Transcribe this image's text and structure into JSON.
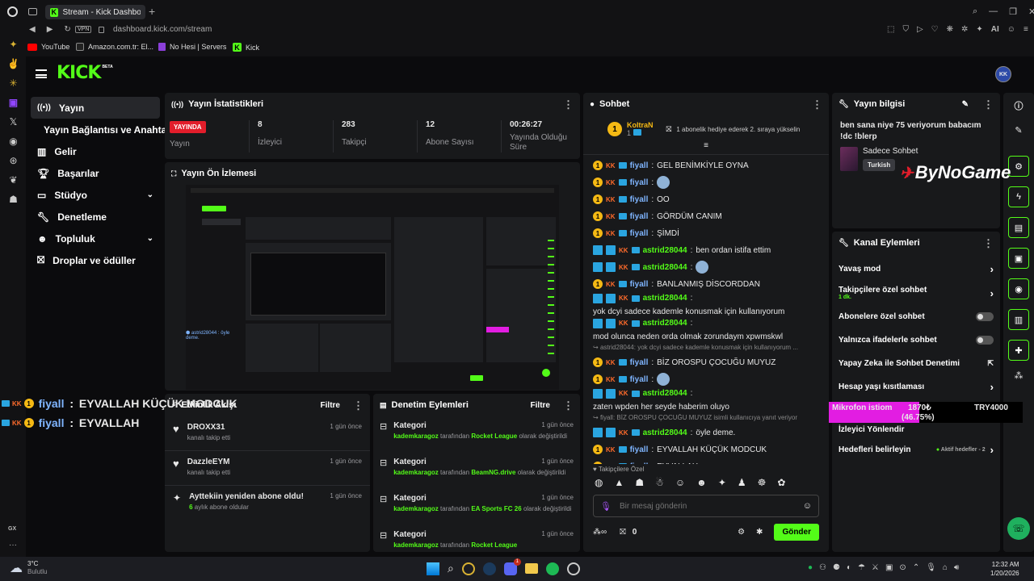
{
  "browser": {
    "tab_title": "Stream - Kick Dashboard",
    "address": "dashboard.kick.com/stream",
    "address_domain": "dashboard.kick.com",
    "address_path": "/stream",
    "vpn_label": "VPN",
    "ai_label": "AI",
    "bookmarks": [
      "YouTube",
      "Amazon.com.tr: El...",
      "No Hesi | Servers",
      "Kick"
    ]
  },
  "opera_sidebar": {
    "gx_label": "GX"
  },
  "kick": {
    "logo": "KICK",
    "beta": "BETA",
    "avatar": "KK",
    "nav": [
      {
        "label": "Yayın",
        "icon": "broadcast-icon"
      },
      {
        "label": "Yayın Bağlantısı ve Anahtarı",
        "icon": ""
      },
      {
        "label": "Gelir",
        "icon": "chart-icon"
      },
      {
        "label": "Başarılar",
        "icon": "trophy-icon"
      },
      {
        "label": "Stüdyo",
        "icon": "studio-icon"
      },
      {
        "label": "Denetleme",
        "icon": "wrench-icon"
      },
      {
        "label": "Topluluk",
        "icon": "community-icon"
      },
      {
        "label": "Droplar ve ödüller",
        "icon": "gift-icon"
      }
    ]
  },
  "stats": {
    "title": "Yayın İstatistikleri",
    "live_badge": "YAYINDA",
    "items": [
      {
        "value": "",
        "label": "Yayın"
      },
      {
        "value": "8",
        "label": "İzleyici"
      },
      {
        "value": "283",
        "label": "Takipçi"
      },
      {
        "value": "12",
        "label": "Abone Sayısı"
      },
      {
        "value": "00:26:27",
        "label": "Yayında Olduğu Süre"
      }
    ]
  },
  "preview": {
    "title": "Yayın Ön İzlemesi"
  },
  "overlay": {
    "lines": [
      {
        "user": "fiyall",
        "text": "EYVALLAH KÜÇÜK MODCUK"
      },
      {
        "user": "fiyall",
        "text": "EYVALLAH"
      }
    ],
    "watermark": "ByNoGame",
    "goal_title": "Mikrofon istiom",
    "goal_progress": "1870₺",
    "goal_target": "TRY4000",
    "goal_percent": "(46.75%)",
    "goal_fraction": 0.4675
  },
  "activity": {
    "title": "Etkinlik Akışı",
    "filter": "Filtre",
    "items": [
      {
        "name": "DROXX31",
        "desc": "kanalı takip etti",
        "time": "1 gün önce",
        "icon": "heart-icon"
      },
      {
        "name": "DazzleEYM",
        "desc": "kanalı takip etti",
        "time": "1 gün önce",
        "icon": "heart-icon"
      },
      {
        "name": "Ayttekiin yeniden abone oldu!",
        "desc_num": "6",
        "desc": "aylık abone oldular",
        "time": "1 gün önce",
        "icon": "sparkle-icon"
      }
    ]
  },
  "moderation": {
    "title": "Denetim Eylemleri",
    "filter": "Filtre",
    "items": [
      {
        "title": "Kategori",
        "time": "1 gün önce",
        "user": "kademkaragoz",
        "mid": "tarafından",
        "category": "Rocket League",
        "suffix": "olarak değiştirildi"
      },
      {
        "title": "Kategori",
        "time": "1 gün önce",
        "user": "kademkaragoz",
        "mid": "tarafından",
        "category": "BeamNG.drive",
        "suffix": "olarak değiştirildi"
      },
      {
        "title": "Kategori",
        "time": "1 gün önce",
        "user": "kademkaragoz",
        "mid": "tarafından",
        "category": "EA Sports FC 26",
        "suffix": "olarak değiştirildi"
      },
      {
        "title": "Kategori",
        "time": "1 gün önce",
        "user": "kademkaragoz",
        "mid": "tarafından",
        "category": "Rocket League",
        "suffix": "olarak değiştirildi"
      }
    ]
  },
  "chat": {
    "title": "Sohbet",
    "pinned_user": "KoltraN",
    "pinned_count": "1",
    "pinned_msg": "1 abonelik hediye ederek 2. sıraya yükselin",
    "messages": [
      {
        "type": "kk",
        "user": "fiyall",
        "text": "GEL BENİMKİYLE OYNA"
      },
      {
        "type": "kk",
        "user": "fiyall",
        "text": "",
        "emote": true
      },
      {
        "type": "kk",
        "user": "fiyall",
        "text": "OO"
      },
      {
        "type": "kk",
        "user": "fiyall",
        "text": "GÖRDÜM CANIM"
      },
      {
        "type": "kk",
        "user": "fiyall",
        "text": "ŞİMDİ"
      },
      {
        "type": "mod",
        "user": "astrid28044",
        "text": "ben ordan istifa ettim"
      },
      {
        "type": "mod",
        "user": "astrid28044",
        "text": "",
        "emote": true
      },
      {
        "type": "kk",
        "user": "fiyall",
        "text": "BANLANMIŞ DİSCORDDAN"
      },
      {
        "type": "mod",
        "user": "astrid28044",
        "text": "yok dcyi sadece kademle konusmak için kullanıyorum"
      },
      {
        "type": "mod",
        "user": "astrid28044",
        "text": "mod olunca neden orda olmak zorundaym xpwmskwl"
      },
      {
        "type": "reply",
        "text": "astrid28044: yok dcyi sadece kademle konusmak için kullanıyorum ..."
      },
      {
        "type": "kk",
        "user": "fiyall",
        "text": "BİZ OROSPU ÇOCUĞU MUYUZ"
      },
      {
        "type": "kk",
        "user": "fiyall",
        "text": "",
        "emote": true
      },
      {
        "type": "mod",
        "user": "astrid28044",
        "text": "zaten wpden her seyde haberim oluyo"
      },
      {
        "type": "reply",
        "text": "fiyall: BİZ OROSPU ÇOCUĞU MUYUZ isimli kullanıcıya yanıt veriyor"
      },
      {
        "type": "mod",
        "user": "astrid28044",
        "text": "öyle deme."
      },
      {
        "type": "kk",
        "user": "fiyall",
        "text": "EYVALLAH KÜÇÜK MODCUK"
      },
      {
        "type": "kk",
        "user": "fiyall",
        "text": "EYVALLAH"
      }
    ],
    "followers_only": "Takipçilere Özel",
    "input_placeholder": "Bir mesaj gönderin",
    "points": "0",
    "send": "Gönder"
  },
  "info": {
    "title": "Yayın bilgisi",
    "stream_title": "ben sana niye 75 veriyorum babacım !dc !blerp",
    "category": "Sadece Sohbet",
    "tags": [
      "Turkish"
    ]
  },
  "actions": {
    "title": "Kanal Eylemleri",
    "rows": [
      {
        "label": "Yavaş mod",
        "control": "chevron"
      },
      {
        "label": "Takipçilere özel sohbet",
        "sub": "1 dk.",
        "control": "chevron"
      },
      {
        "label": "Abonelere özel sohbet",
        "control": "toggle"
      },
      {
        "label": "Yalnızca ifadelerle sohbet",
        "control": "toggle"
      },
      {
        "label": "Yapay Zeka ile Sohbet Denetimi",
        "control": "external"
      },
      {
        "label": "Hesap yaşı kısıtlaması",
        "control": "chevron"
      },
      {
        "label": "İzleyici Yönlendir",
        "control": "none"
      },
      {
        "label": "Hedefleri belirleyin",
        "extra": "Aktif hedefler - 2",
        "control": "chevron"
      }
    ]
  },
  "taskbar": {
    "weather_temp": "3°C",
    "weather_desc": "Bulutlu",
    "time": "12:32 AM",
    "date": "1/20/2026",
    "badge": "1"
  }
}
